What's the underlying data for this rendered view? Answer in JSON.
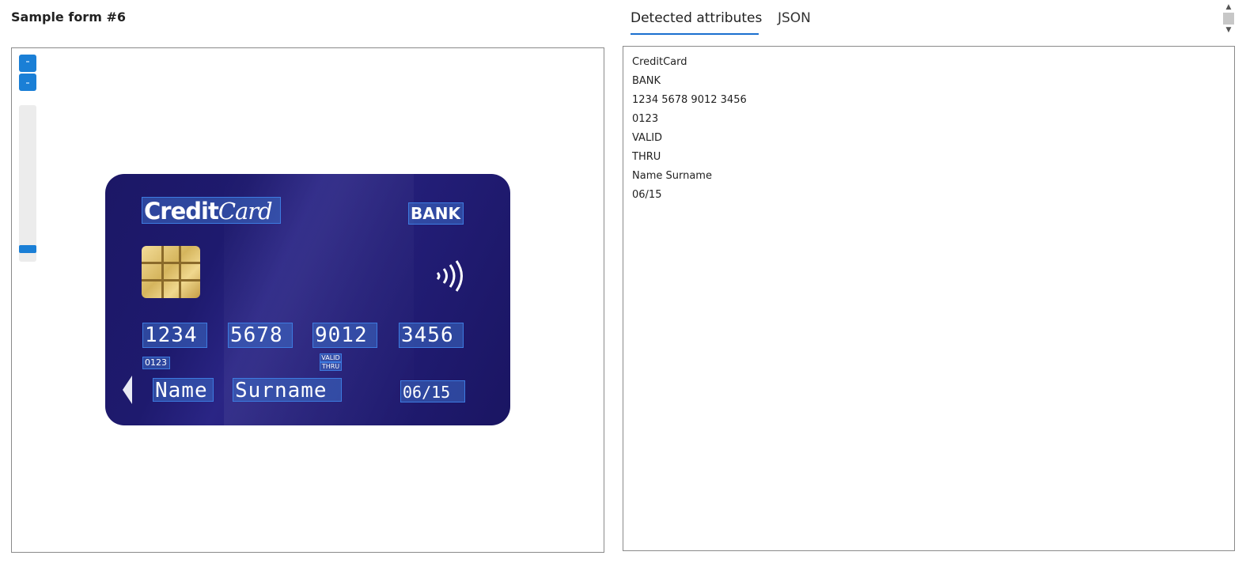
{
  "left_panel": {
    "title": "Sample form #6"
  },
  "card": {
    "brand_bold": "Credit",
    "brand_script": "Card",
    "bank": "BANK",
    "number_groups": [
      "1234",
      "5678",
      "9012",
      "3456"
    ],
    "small_code": "0123",
    "valid_line1": "VALID",
    "valid_line2": "THRU",
    "holder_first": "Name",
    "holder_last": "Surname",
    "expiry": "06/15"
  },
  "right_panel": {
    "tabs": [
      {
        "label": "Detected attributes",
        "active": true
      },
      {
        "label": "JSON",
        "active": false
      }
    ],
    "attributes": [
      "CreditCard",
      "BANK",
      "1234 5678 9012 3456",
      "0123",
      "VALID",
      "THRU",
      "Name Surname",
      "06/15"
    ]
  },
  "colors": {
    "accent": "#1a6fcf",
    "card_bg": "#1e1a6e",
    "highlight": "#3d7be0"
  },
  "zoom": {
    "level": 0.06
  }
}
